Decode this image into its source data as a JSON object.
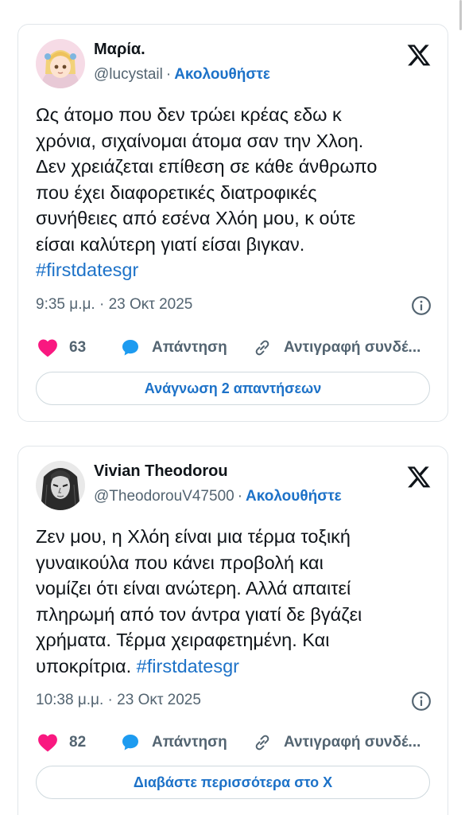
{
  "tweets": [
    {
      "name": "Μαρία.",
      "handle": "@lucystail",
      "separator": "·",
      "follow": "Ακολουθήστε",
      "lines": [
        "Ως άτομο που δεν τρώει κρέας εδω κ",
        "χρόνια, σιχαίνομαι άτομα σαν την Χλοη.",
        "Δεν χρειάζεται επίθεση σε κάθε άνθρωπο",
        "που έχει διαφορετικές διατροφικές",
        "συνήθειες από εσένα Χλόη μου, κ ούτε",
        "είσαι καλύτερη γιατί είσαι βιγκαν."
      ],
      "hashtag_line_prefix": "",
      "hashtag": "#firstdatesgr",
      "timestamp": "9:35 μ.μ. · 23 Οκτ 2025",
      "likes": "63",
      "reply_label": "Απάντηση",
      "copy_label": "Αντιγραφή συνδέ...",
      "cta": "Ανάγνωση 2 απαντήσεων"
    },
    {
      "name": "Vivian Theodorou",
      "handle": "@TheodorouV47500",
      "separator": "·",
      "follow": "Ακολουθήστε",
      "lines": [
        "Ζεν μου, η Χλόη είναι μια τέρμα τοξική",
        "γυναικούλα που κάνει προβολή και",
        "νομίζει ότι είναι ανώτερη. Αλλά απαιτεί",
        "πληρωμή από τον άντρα γιατί δε βγάζει",
        "χρήματα. Τέρμα χειραφετημένη. Και"
      ],
      "hashtag_line_prefix": "υποκρίτρια. ",
      "hashtag": "#firstdatesgr",
      "timestamp": "10:38 μ.μ. · 23 Οκτ 2025",
      "likes": "82",
      "reply_label": "Απάντηση",
      "copy_label": "Αντιγραφή συνδέ...",
      "cta": "Διαβάστε περισσότερα στο X"
    }
  ],
  "colors": {
    "accent": "#1d72c8",
    "like": "#f91880",
    "secondary": "#536471",
    "text": "#0f1419"
  },
  "icons": [
    "x-logo-icon",
    "info-icon",
    "heart-icon",
    "reply-bubble-icon",
    "link-icon"
  ]
}
